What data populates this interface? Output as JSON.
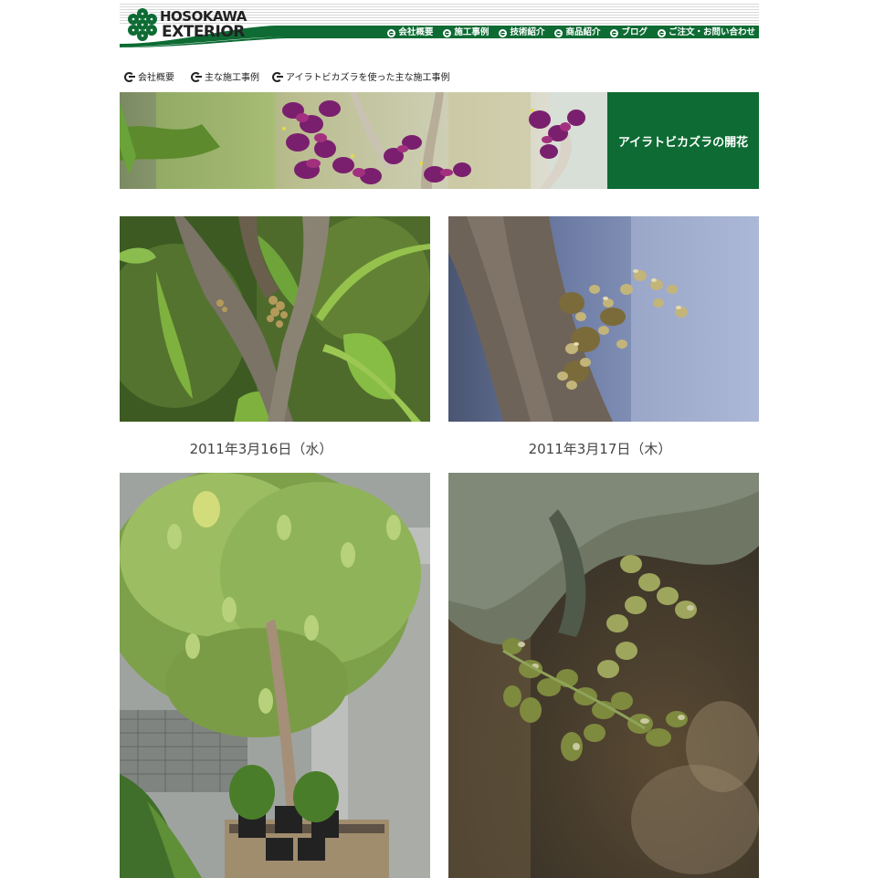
{
  "logo": {
    "line1": "HOSOKAWA",
    "line2": "EXTERIOR",
    "icon": "flower-logo-icon"
  },
  "nav": [
    {
      "label": "会社概要"
    },
    {
      "label": "施工事例"
    },
    {
      "label": "技術紹介"
    },
    {
      "label": "商品紹介"
    },
    {
      "label": "ブログ"
    },
    {
      "label": "ご注文・お問い合わせ"
    }
  ],
  "breadcrumb": [
    {
      "label": "会社概要"
    },
    {
      "label": "主な施工事例"
    },
    {
      "label": "アイラトビカズラを使った主な施工事例"
    }
  ],
  "banner": {
    "title": "アイラトビカズラの開花"
  },
  "photos": [
    {
      "caption": "2011年3月16日（水）"
    },
    {
      "caption": "2011年3月17日（木）"
    }
  ],
  "colors": {
    "brand_green": "#0d6b33",
    "stripe_gray": "#d8d8d8"
  }
}
